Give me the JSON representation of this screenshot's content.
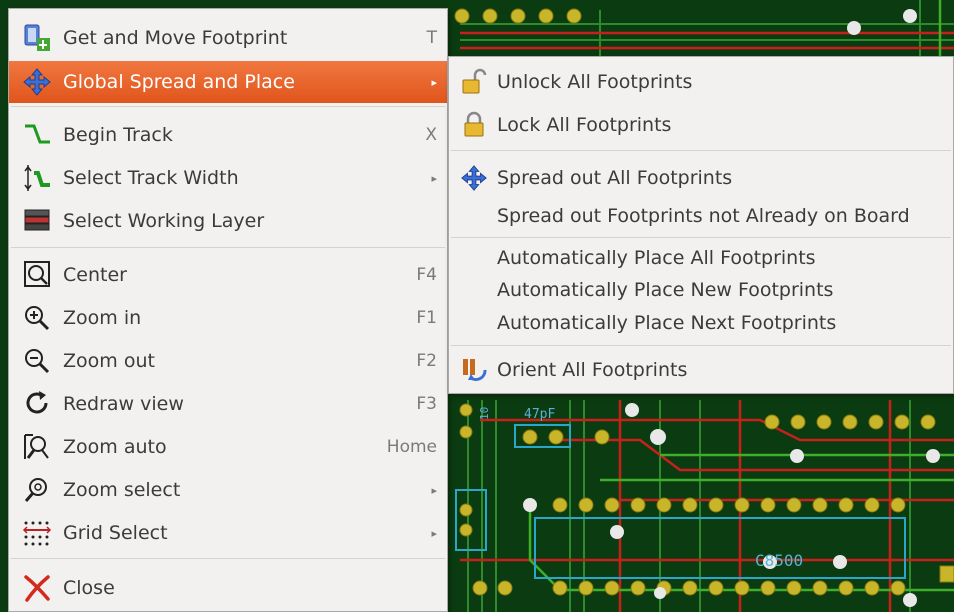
{
  "menu": {
    "items": [
      {
        "label": "Get and Move Footprint",
        "shortcut": "T",
        "icon": "get-move-footprint-icon"
      },
      {
        "label": "Global Spread and Place",
        "shortcut": "",
        "icon": "move-arrows-icon"
      },
      {
        "label": "Begin Track",
        "shortcut": "X",
        "icon": "begin-track-icon"
      },
      {
        "label": "Select Track Width",
        "shortcut": "",
        "icon": "track-width-icon"
      },
      {
        "label": "Select Working Layer",
        "shortcut": "",
        "icon": "layers-icon"
      },
      {
        "label": "Center",
        "shortcut": "F4",
        "icon": "center-icon"
      },
      {
        "label": "Zoom in",
        "shortcut": "F1",
        "icon": "zoom-in-icon"
      },
      {
        "label": "Zoom out",
        "shortcut": "F2",
        "icon": "zoom-out-icon"
      },
      {
        "label": "Redraw view",
        "shortcut": "F3",
        "icon": "redraw-icon"
      },
      {
        "label": "Zoom auto",
        "shortcut": "Home",
        "icon": "zoom-auto-icon"
      },
      {
        "label": "Zoom select",
        "shortcut": "",
        "icon": "zoom-select-icon"
      },
      {
        "label": "Grid Select",
        "shortcut": "",
        "icon": "grid-icon"
      },
      {
        "label": "Close",
        "shortcut": "",
        "icon": "close-icon"
      }
    ]
  },
  "submenu": {
    "items": [
      {
        "label": "Unlock All Footprints",
        "icon": "unlock-icon"
      },
      {
        "label": "Lock All Footprints",
        "icon": "lock-icon"
      },
      {
        "label": "Spread out All Footprints",
        "icon": "move-arrows-icon"
      },
      {
        "label": "Spread out Footprints not Already on Board",
        "icon": ""
      },
      {
        "label": "Automatically Place All Footprints",
        "icon": ""
      },
      {
        "label": "Automatically Place New Footprints",
        "icon": ""
      },
      {
        "label": "Automatically Place Next Footprints",
        "icon": ""
      },
      {
        "label": "Orient All Footprints",
        "icon": "orient-icon"
      }
    ]
  },
  "pcb": {
    "labels": [
      "47pF",
      "C8500",
      "10"
    ]
  },
  "colors": {
    "accent": "#e8622a",
    "board": "#0b3b10",
    "track_red": "#c8201c",
    "track_green": "#3fae2a",
    "pad_yellow": "#c9b52a"
  }
}
